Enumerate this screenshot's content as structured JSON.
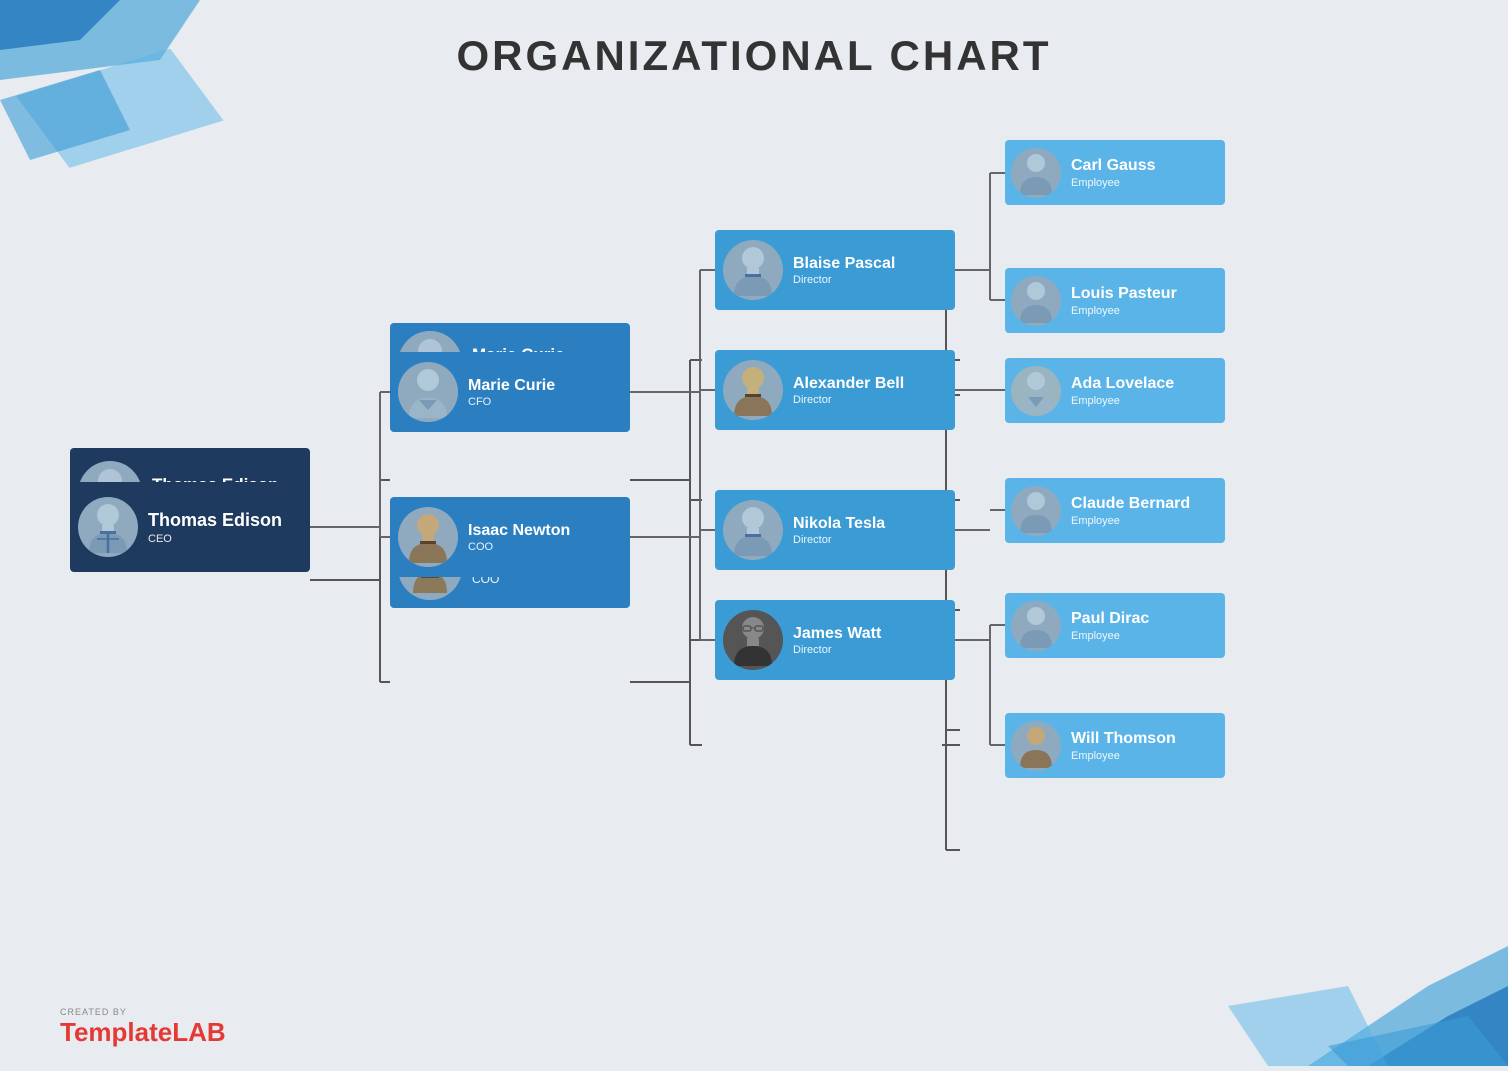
{
  "title": "ORGANIZATIONAL CHART",
  "nodes": {
    "ceo": {
      "name": "Thomas Edison",
      "role": "CEO"
    },
    "cfo": {
      "name": "Marie Curie",
      "role": "CFO"
    },
    "coo": {
      "name": "Isaac Newton",
      "role": "COO"
    },
    "directors": [
      {
        "name": "Blaise Pascal",
        "role": "Director"
      },
      {
        "name": "Alexander Bell",
        "role": "Director"
      },
      {
        "name": "Nikola Tesla",
        "role": "Director"
      },
      {
        "name": "James Watt",
        "role": "Director"
      }
    ],
    "employees": [
      {
        "name": "Carl Gauss",
        "role": "Employee"
      },
      {
        "name": "Louis Pasteur",
        "role": "Employee"
      },
      {
        "name": "Ada Lovelace",
        "role": "Employee"
      },
      {
        "name": "Claude Bernard",
        "role": "Employee"
      },
      {
        "name": "Paul Dirac",
        "role": "Employee"
      },
      {
        "name": "Will Thomson",
        "role": "Employee"
      }
    ]
  },
  "footer": {
    "created_by": "CREATED BY",
    "brand_part1": "Template",
    "brand_part2": "LAB"
  }
}
